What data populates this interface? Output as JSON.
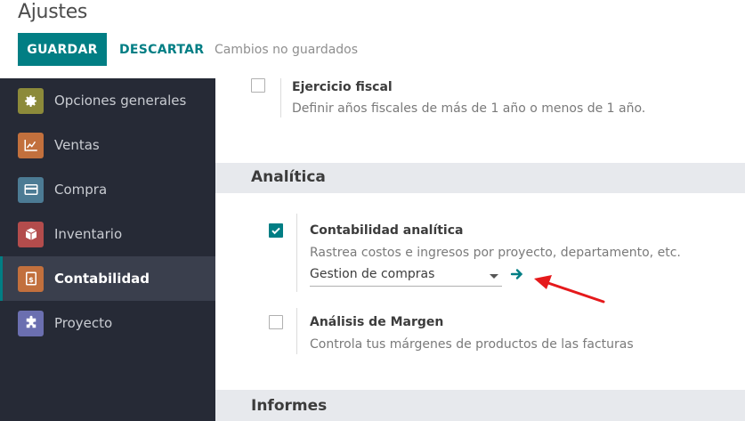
{
  "header": {
    "title": "Ajustes",
    "save_label": "GUARDAR",
    "discard_label": "DESCARTAR",
    "status": "Cambios no guardados"
  },
  "sidebar": {
    "items": [
      {
        "label": "Opciones generales",
        "icon": "gear-icon",
        "color": "#8c8a3a",
        "active": false
      },
      {
        "label": "Ventas",
        "icon": "chart-icon",
        "color": "#c2703d",
        "active": false
      },
      {
        "label": "Compra",
        "icon": "credit-card-icon",
        "color": "#4c7b94",
        "active": false
      },
      {
        "label": "Inventario",
        "icon": "box-icon",
        "color": "#b34c4c",
        "active": false
      },
      {
        "label": "Contabilidad",
        "icon": "invoice-icon",
        "color": "#c2703d",
        "active": true
      },
      {
        "label": "Proyecto",
        "icon": "puzzle-icon",
        "color": "#6b6fb0",
        "active": false
      }
    ]
  },
  "main": {
    "fiscal_year": {
      "title": "Ejercicio fiscal",
      "description": "Definir años fiscales de más de 1 año o menos de 1 año.",
      "checked": false
    },
    "analytics_section": {
      "title": "Analítica"
    },
    "analytic_accounting": {
      "title": "Contabilidad analítica",
      "description": "Rastrea costos e ingresos por proyecto, departamento, etc.",
      "checked": true,
      "select_value": "Gestion de compras"
    },
    "margin_analysis": {
      "title": "Análisis de Margen",
      "description": "Controla tus márgenes de productos de las facturas",
      "checked": false
    },
    "reports_section": {
      "title": "Informes"
    }
  },
  "colors": {
    "primary": "#017e84",
    "sidebar_bg": "#262a36",
    "annotation_arrow": "#e5191b"
  }
}
